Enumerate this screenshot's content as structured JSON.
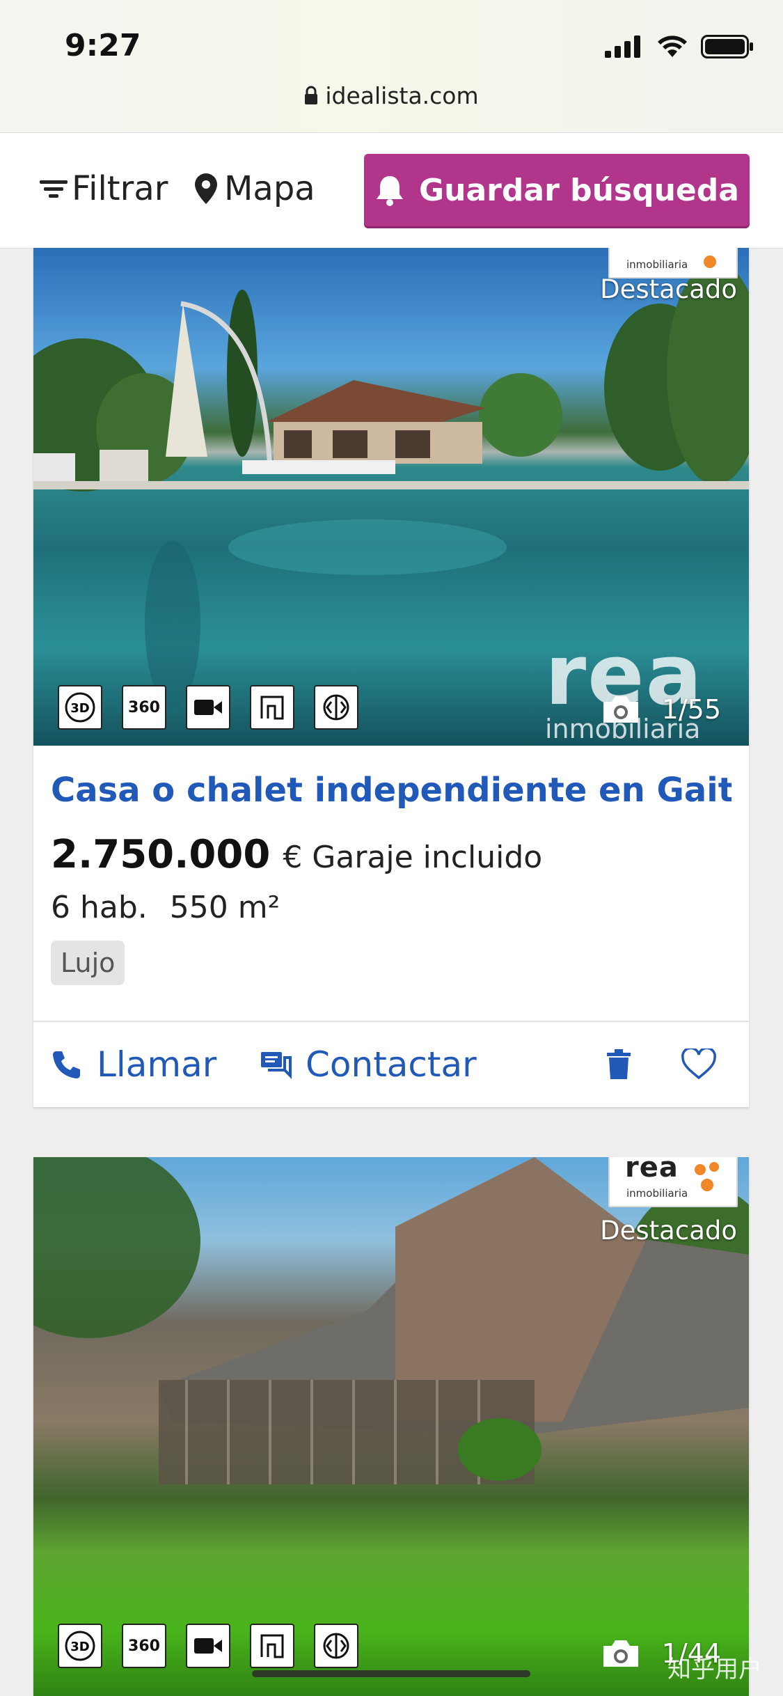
{
  "status_bar": {
    "time": "9:27",
    "url": "idealista.com"
  },
  "header": {
    "filter_label": "Filtrar",
    "map_label": "Mapa",
    "save_search_label": "Guardar búsqueda"
  },
  "listings": [
    {
      "agency_brand": "",
      "agency_sub": "inmobiliaria",
      "badge": "Destacado",
      "media_icons": [
        "3D",
        "360",
        "video-icon",
        "floorplan-icon",
        "virtual-tour-icon"
      ],
      "photo_count": "1/55",
      "watermark_brand": "rea",
      "watermark_sub": "inmobiliaria",
      "title": "Casa o chalet independiente en Gaitan...",
      "price": "2.750.000",
      "price_extra": "€ Garaje incluido",
      "rooms": "6 hab.",
      "area": "550 m²",
      "tag": "Lujo",
      "actions": {
        "call": "Llamar",
        "contact": "Contactar"
      }
    },
    {
      "agency_brand": "rea",
      "agency_sub": "inmobiliaria",
      "badge": "Destacado",
      "media_icons": [
        "3D",
        "360",
        "video-icon",
        "floorplan-icon",
        "virtual-tour-icon"
      ],
      "photo_count": "1/44"
    }
  ],
  "watermark": "知乎用户",
  "colors": {
    "brand_magenta": "#b2358c",
    "link_blue": "#2059b8",
    "accent_orange": "#f08f2a"
  }
}
